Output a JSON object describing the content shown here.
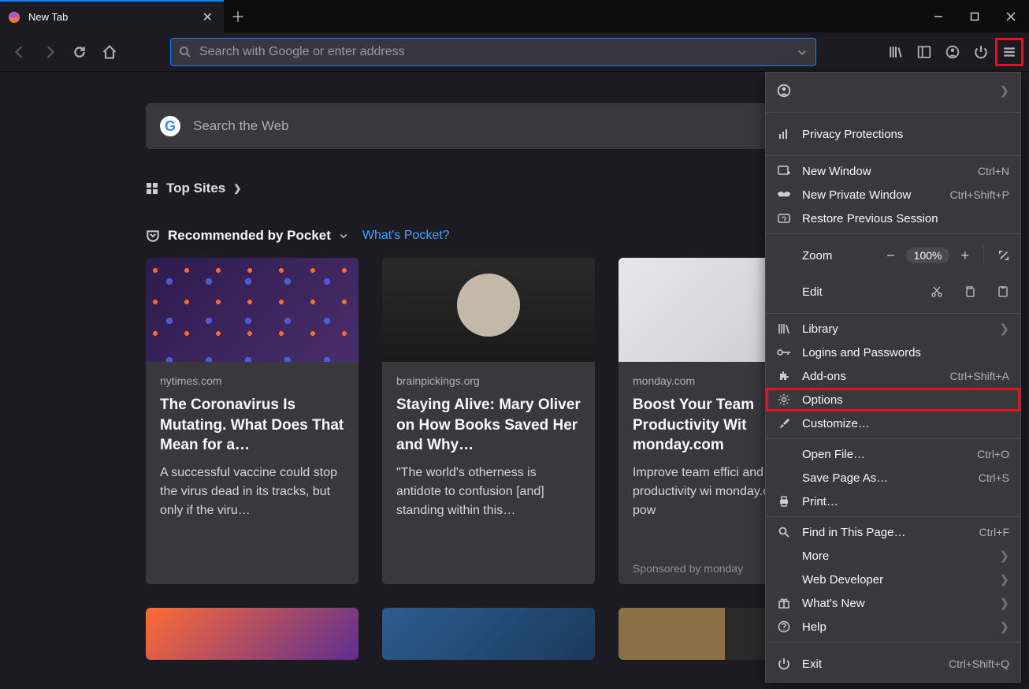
{
  "tab": {
    "title": "New Tab"
  },
  "urlbar": {
    "placeholder": "Search with Google or enter address"
  },
  "newtab": {
    "search_placeholder": "Search the Web",
    "topsites_label": "Top Sites",
    "pocket_label": "Recommended by Pocket",
    "pocket_link": "What's Pocket?"
  },
  "cards": [
    {
      "domain": "nytimes.com",
      "title": "The Coronavirus Is Mutating. What Does That Mean for a…",
      "excerpt": "A successful vaccine could stop the virus dead in its tracks, but only if the viru…"
    },
    {
      "domain": "brainpickings.org",
      "title": "Staying Alive: Mary Oliver on How Books Saved Her and Why…",
      "excerpt": "\"The world's otherness is antidote to confusion [and] standing within this…"
    },
    {
      "domain": "monday.com",
      "title": "Boost Your Team Productivity Wit monday.com",
      "excerpt": "Improve team effici and productivity wi monday.com, a pow",
      "sponsor": "Sponsored by monday"
    }
  ],
  "menu": {
    "privacy": "Privacy Protections",
    "new_window": "New Window",
    "new_window_key": "Ctrl+N",
    "new_private": "New Private Window",
    "new_private_key": "Ctrl+Shift+P",
    "restore": "Restore Previous Session",
    "zoom_label": "Zoom",
    "zoom_value": "100%",
    "edit_label": "Edit",
    "library": "Library",
    "logins": "Logins and Passwords",
    "addons": "Add-ons",
    "addons_key": "Ctrl+Shift+A",
    "options": "Options",
    "customize": "Customize…",
    "open_file": "Open File…",
    "open_file_key": "Ctrl+O",
    "save_as": "Save Page As…",
    "save_as_key": "Ctrl+S",
    "print": "Print…",
    "find": "Find in This Page…",
    "find_key": "Ctrl+F",
    "more": "More",
    "webdev": "Web Developer",
    "whatsnew": "What's New",
    "help": "Help",
    "exit": "Exit",
    "exit_key": "Ctrl+Shift+Q"
  }
}
